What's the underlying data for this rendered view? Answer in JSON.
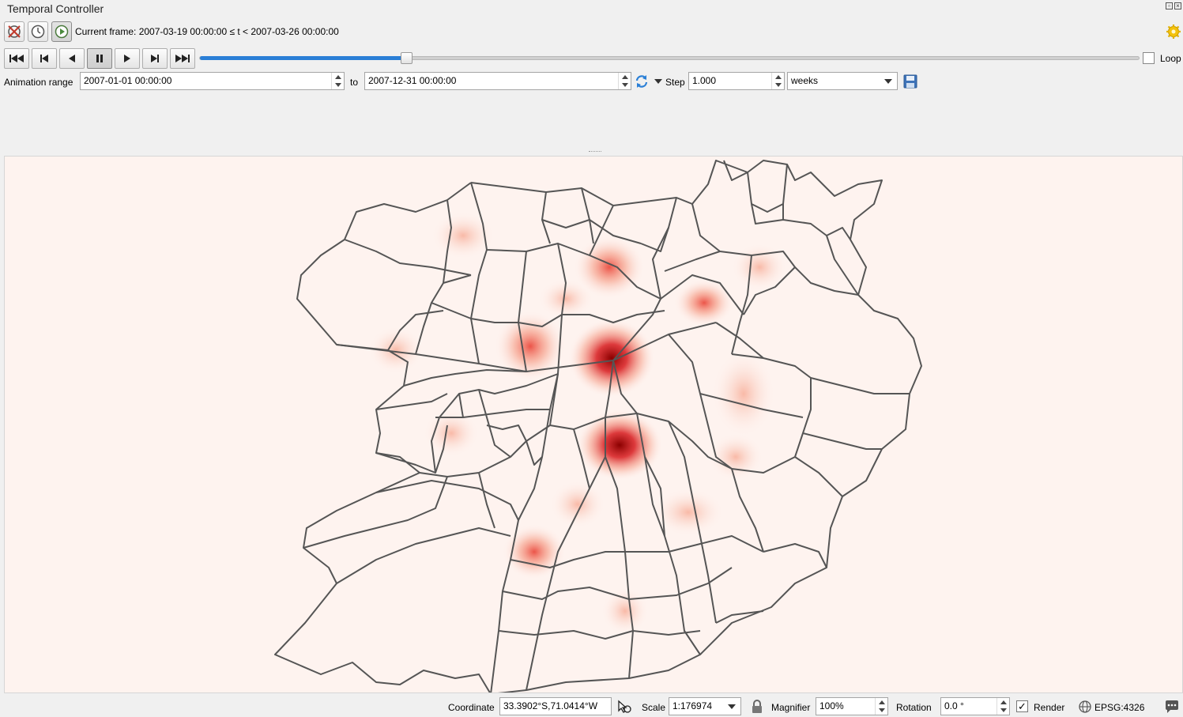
{
  "panel": {
    "title": "Temporal Controller"
  },
  "toolbar": {
    "fixed_range_icon": "fixed-range-icon",
    "frame_label": "Current frame: 2007-03-19 00:00:00 ≤ t < 2007-03-26 00:00:00",
    "settings_icon": "gear-icon"
  },
  "navigation": {
    "buttons": [
      "rewind-to-start",
      "previous-frame",
      "play-backward",
      "pause",
      "play-forward",
      "next-frame",
      "skip-to-end"
    ],
    "slider_position": 0.22,
    "loop_label": "Loop",
    "loop_checked": false
  },
  "range": {
    "label": "Animation range",
    "start": "2007-01-01 00:00:00",
    "to_label": "to",
    "end": "2007-12-31 00:00:00",
    "step_label": "Step",
    "step_value": "1.000",
    "step_unit": "weeks"
  },
  "statusbar": {
    "coordinate_label": "Coordinate",
    "coordinate_value": "33.3902°S,71.0414°W",
    "scale_label": "Scale",
    "scale_value": "1:176974",
    "magnifier_label": "Magnifier",
    "magnifier_value": "100%",
    "rotation_label": "Rotation",
    "rotation_value": "0.0 °",
    "render_label": "Render",
    "render_checked": true,
    "crs_label": "EPSG:4326"
  },
  "colors": {
    "heat": "#d7191c",
    "map_background": "#fef3ef",
    "boundary": "#555555",
    "accent": "#2a7fd6"
  }
}
